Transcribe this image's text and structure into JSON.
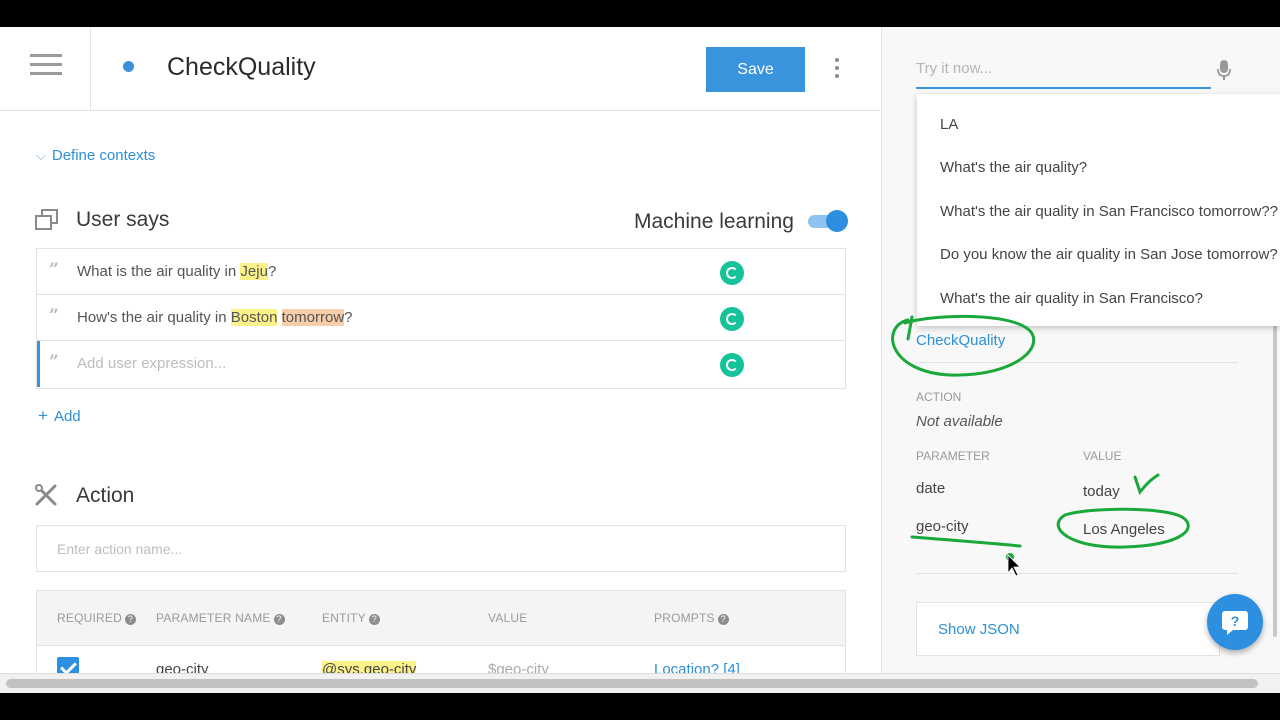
{
  "header": {
    "intent_title": "CheckQuality",
    "save_label": "Save"
  },
  "contexts": {
    "label": "Define contexts"
  },
  "user_says": {
    "title": "User says",
    "ml_label": "Machine learning",
    "ml_enabled": true,
    "rows": [
      {
        "parts": [
          {
            "text": "What is the air quality in "
          },
          {
            "text": "Jeju",
            "hl": "yellow"
          },
          {
            "text": "?"
          }
        ]
      },
      {
        "parts": [
          {
            "text": "How's the air quality in "
          },
          {
            "text": "Boston",
            "hl": "yellow"
          },
          {
            "text": " "
          },
          {
            "text": "tomorrow",
            "hl": "orange"
          },
          {
            "text": "?"
          }
        ]
      }
    ],
    "add_placeholder": "Add user expression...",
    "add_label": "Add"
  },
  "action": {
    "title": "Action",
    "name_placeholder": "Enter action name...",
    "columns": {
      "required": "REQUIRED",
      "parameter_name": "PARAMETER NAME",
      "entity": "ENTITY",
      "value": "VALUE",
      "prompts": "PROMPTS"
    },
    "rows": [
      {
        "required": true,
        "parameter_name": "geo-city",
        "entity": "@sys.geo-city",
        "value": "$geo-city",
        "prompts": "Location? [4]"
      }
    ]
  },
  "try_it": {
    "placeholder": "Try it now...",
    "suggestions": [
      "LA",
      "What's the air quality?",
      "What's the air quality in San Francisco tomorrow??",
      "Do you know the air quality in San Jose tomorrow?",
      "What's the air quality in San Francisco?"
    ]
  },
  "result": {
    "intent": "CheckQuality",
    "action_label": "ACTION",
    "action_value": "Not available",
    "parameter_label": "PARAMETER",
    "value_label": "VALUE",
    "params": [
      {
        "name": "date",
        "value": "today"
      },
      {
        "name": "geo-city",
        "value": "Los Angeles"
      }
    ],
    "show_json_label": "Show JSON"
  },
  "colors": {
    "accent": "#3a93dd",
    "link": "#2d8fd6",
    "annotation_green": "#1aa83a"
  }
}
